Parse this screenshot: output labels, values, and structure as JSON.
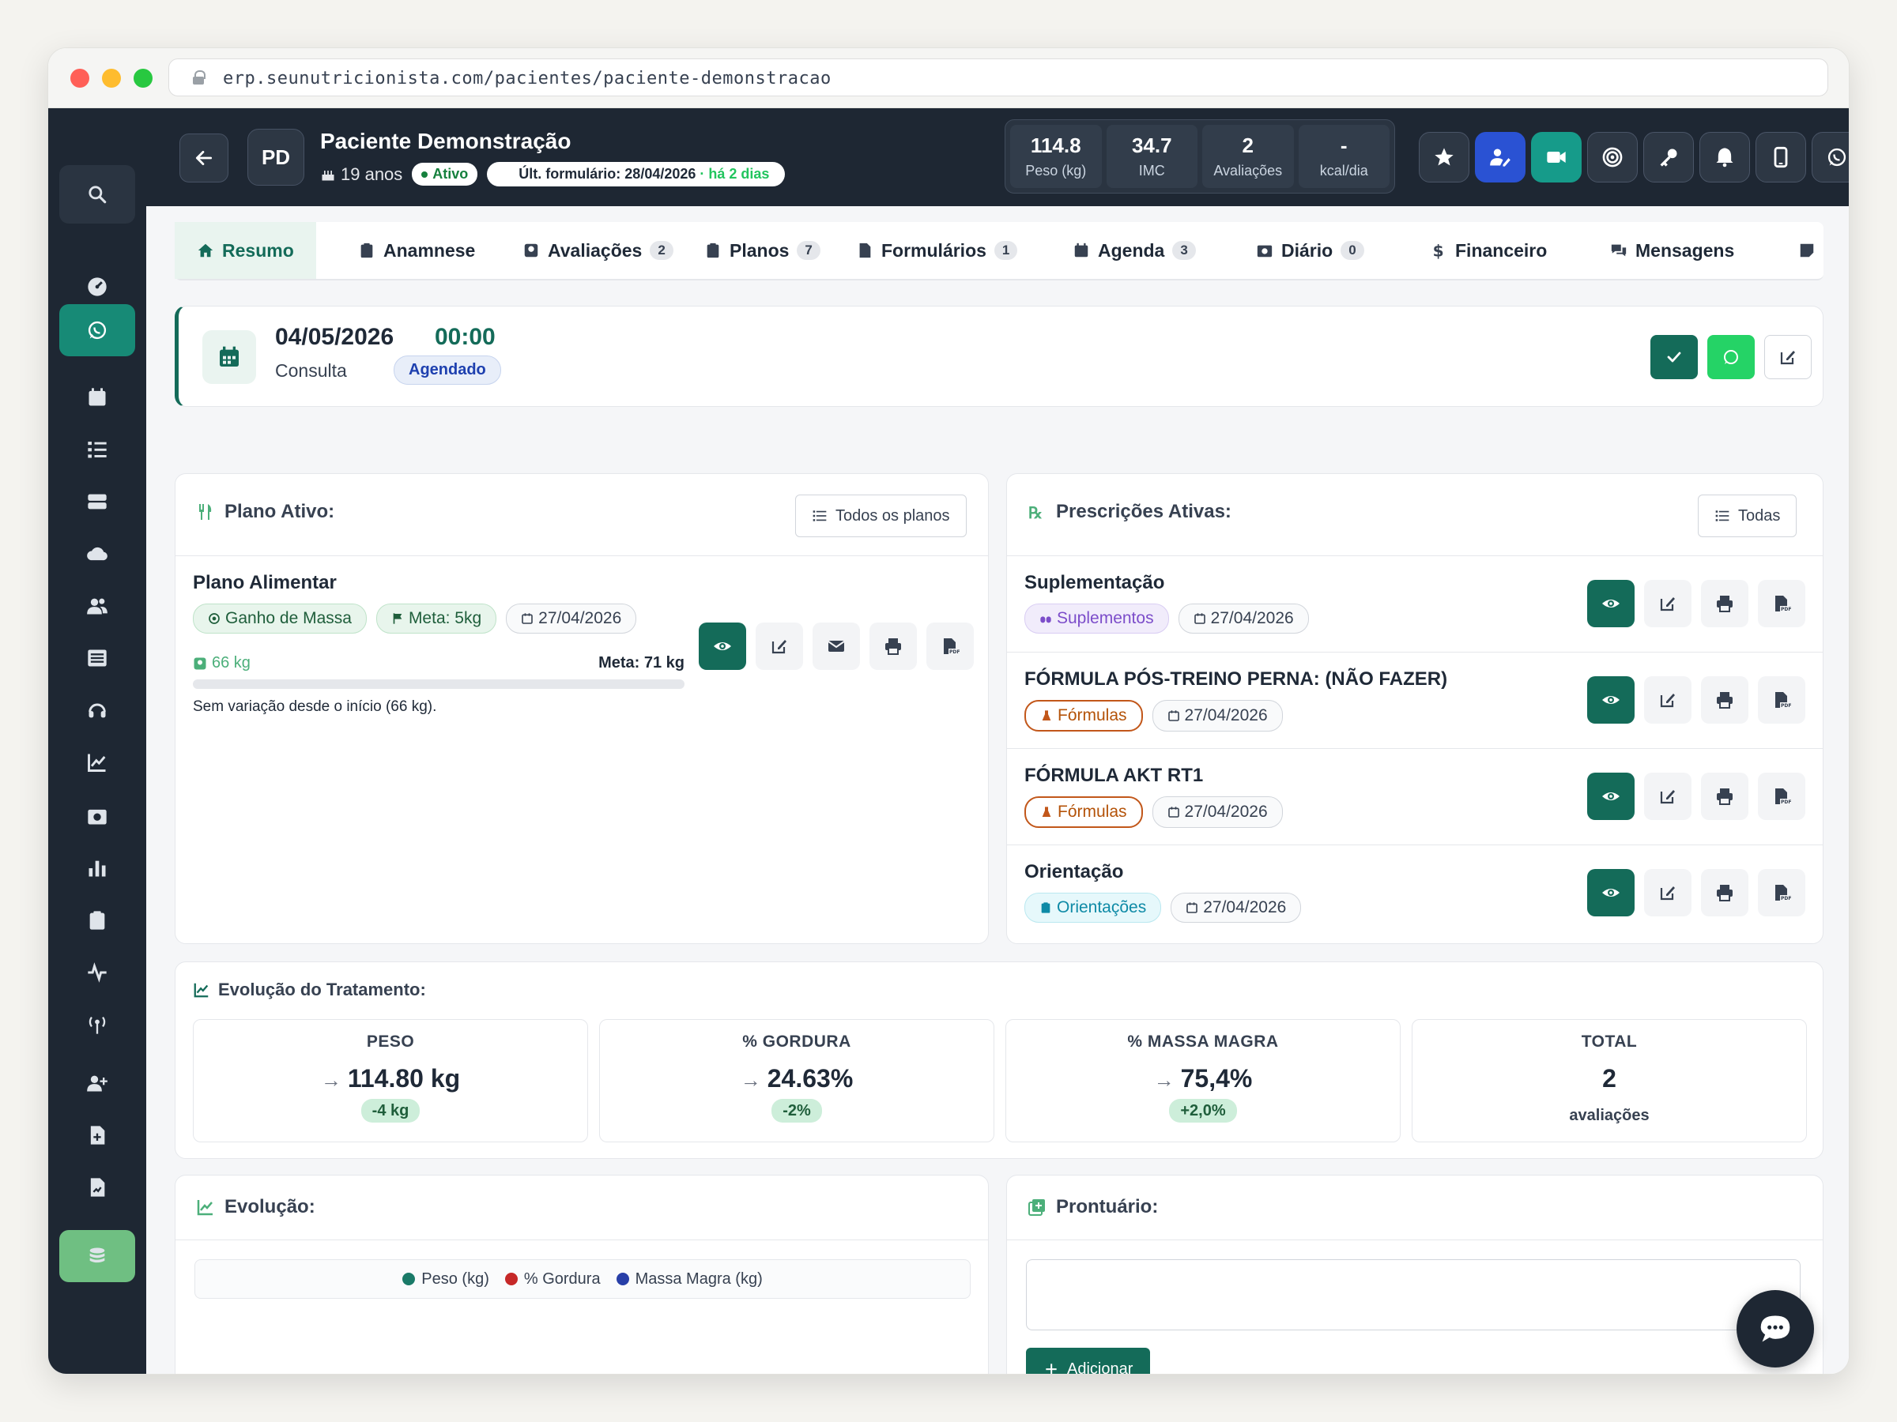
{
  "browser": {
    "url": "erp.seunutricionista.com/pacientes/paciente-demonstracao"
  },
  "patient": {
    "initials": "PD",
    "name": "Paciente Demonstração",
    "age": "19 anos",
    "status": "Ativo",
    "last_form": "Últ. formulário: 28/04/2026",
    "last_form_recent": " · há 2 dias"
  },
  "stats": [
    {
      "value": "114.8",
      "label": "Peso (kg)"
    },
    {
      "value": "34.7",
      "label": "IMC"
    },
    {
      "value": "2",
      "label": "Avaliações"
    },
    {
      "value": "-",
      "label": "kcal/dia"
    }
  ],
  "topbar_actions": [
    "star-icon",
    "user-edit-icon",
    "video-icon",
    "target-icon",
    "key-icon",
    "bell-icon",
    "mobile-icon",
    "whatsapp-icon"
  ],
  "tabs": [
    {
      "label": "Resumo",
      "icon": "home-icon",
      "count": ""
    },
    {
      "label": "Anamnese",
      "icon": "clipboard-icon",
      "count": ""
    },
    {
      "label": "Avaliações",
      "icon": "scale-icon",
      "count": "2"
    },
    {
      "label": "Planos",
      "icon": "clipboard-icon",
      "count": "7"
    },
    {
      "label": "Formulários",
      "icon": "file-icon",
      "count": "1"
    },
    {
      "label": "Agenda",
      "icon": "calendar-icon",
      "count": "3"
    },
    {
      "label": "Diário",
      "icon": "diary-icon",
      "count": "0"
    },
    {
      "label": "Financeiro",
      "icon": "dollar-icon",
      "count": ""
    },
    {
      "label": "Mensagens",
      "icon": "comments-icon",
      "count": ""
    }
  ],
  "appointment": {
    "date": "04/05/2026",
    "time": "00:00",
    "type": "Consulta",
    "status": "Agendado"
  },
  "plan_panel": {
    "title": "Plano Ativo:",
    "all_button": "Todos os planos",
    "plan_name": "Plano Alimentar",
    "chips": {
      "goal": "Ganho de Massa",
      "target": "Meta: 5kg",
      "date": "27/04/2026"
    },
    "current_weight": "66 kg",
    "target_weight": "Meta: 71 kg",
    "progress": 0,
    "note": "Sem variação desde o início (66 kg)."
  },
  "prescriptions_panel": {
    "title": "Prescrições Ativas:",
    "all_button": "Todas",
    "items": [
      {
        "name": "Suplementação",
        "tag": "Suplementos",
        "tag_style": "purple",
        "date": "27/04/2026"
      },
      {
        "name": "FÓRMULA PÓS-TREINO PERNA: (NÃO FAZER)",
        "tag": "Fórmulas",
        "tag_style": "orange",
        "date": "27/04/2026"
      },
      {
        "name": "FÓRMULA AKT RT1",
        "tag": "Fórmulas",
        "tag_style": "orange",
        "date": "27/04/2026"
      },
      {
        "name": "Orientação",
        "tag": "Orientações",
        "tag_style": "cyan",
        "date": "27/04/2026"
      }
    ]
  },
  "treatment": {
    "title": "Evolução do Tratamento:",
    "metrics": [
      {
        "label": "PESO",
        "value": "114.80 kg",
        "delta": "-4 kg"
      },
      {
        "label": "% GORDURA",
        "value": "24.63%",
        "delta": "-2%"
      },
      {
        "label": "% MASSA MAGRA",
        "value": "75,4%",
        "delta": "+2,0%"
      },
      {
        "label": "TOTAL",
        "value": "2",
        "sub": "avaliações"
      }
    ]
  },
  "evolution_chart": {
    "title": "Evolução:",
    "legend": [
      {
        "name": "Peso (kg)",
        "color": "#1a7a68"
      },
      {
        "name": "% Gordura",
        "color": "#c62828"
      },
      {
        "name": "Massa Magra (kg)",
        "color": "#283fa8"
      }
    ]
  },
  "records": {
    "title": "Prontuário:",
    "add_button": "Adicionar",
    "note_value": ""
  }
}
